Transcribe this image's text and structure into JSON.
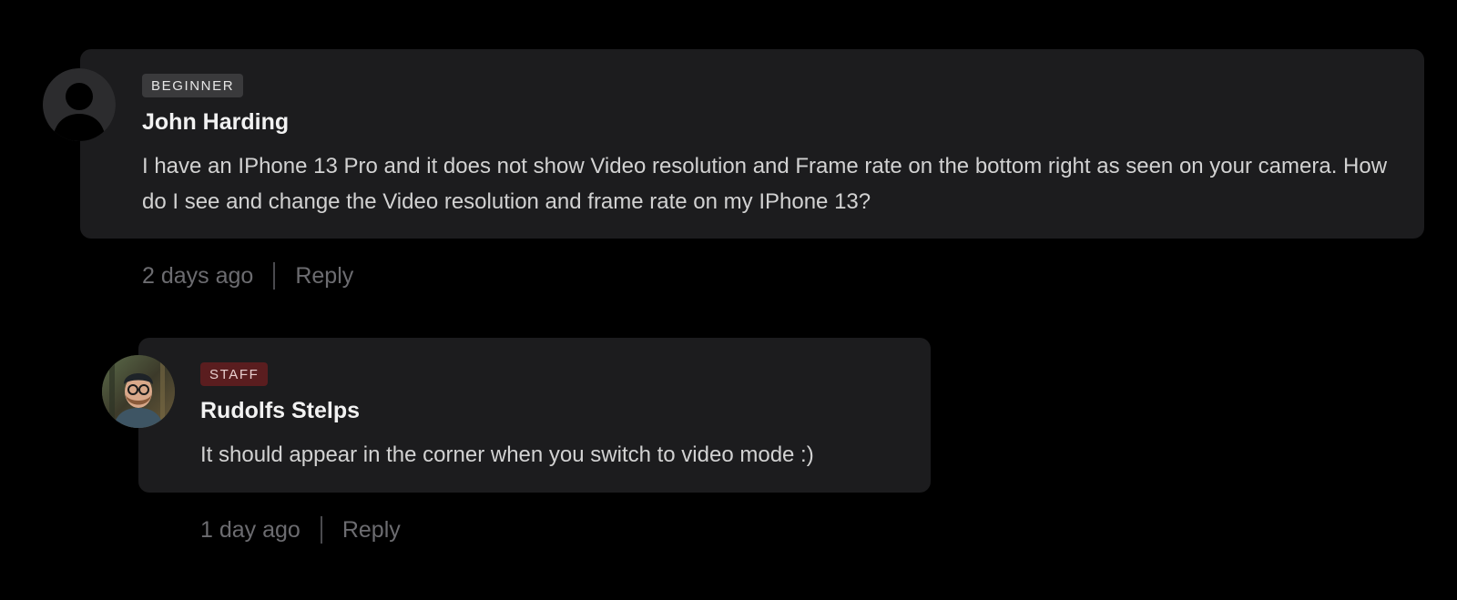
{
  "comments": [
    {
      "badge": "BEGINNER",
      "author": "John Harding",
      "text": "I have an IPhone 13 Pro and it does not show Video resolution and Frame rate on the bottom right as seen on your camera. How do I see and change the Video resolution and frame rate on my IPhone 13?",
      "time": "2 days ago",
      "reply_label": "Reply",
      "avatar_icon": "default-user-icon"
    },
    {
      "badge": "STAFF",
      "author": "Rudolfs Stelps",
      "text": "It should appear in the corner when you switch to video mode :)",
      "time": "1 day ago",
      "reply_label": "Reply",
      "avatar_icon": "user-photo"
    }
  ],
  "colors": {
    "background": "#000000",
    "card": "#1c1c1e",
    "beginner_badge": "#3a3a3c",
    "staff_badge": "#5a1d1f",
    "meta_text": "#6c6c70"
  }
}
